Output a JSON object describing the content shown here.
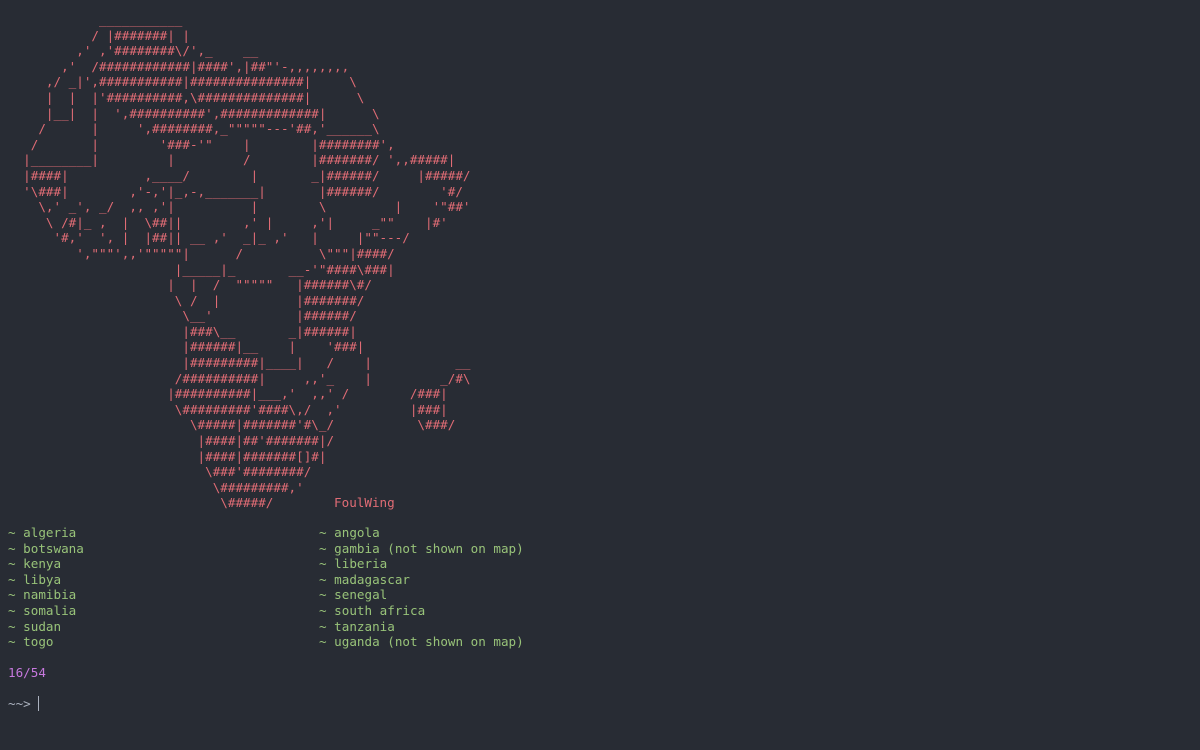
{
  "art": {
    "lines": [
      "            ___________",
      "           / |#######| |",
      "         ,' ,'########\\/',_    __",
      "       ,'  /############|####',|##\"'-,,,,,,,,",
      "     ,/ _|',###########|###############|     \\",
      "     |  |  |'##########,\\##############|      \\",
      "     |__|  |  ',##########',#############|      \\",
      "    /      |     ',########,_\"\"\"\"\"---'##,'______\\",
      "   /       |        '###-'\"    |        |########',",
      "  |________|         |         /        |#######/ ',,#####|",
      "  |####|          ,____/        |       _|######/     |#####/",
      "  '\\###|        ,'-,'|_,-,_______|       |######/        '#/",
      "    \\,' _', _/  ,, ,'|          |        \\         |    '\"##'",
      "     \\ /#|_ ,  |  \\##||        ,' |     ,'|     _\"\"    |#'",
      "      '#,'  ', |  |##|| __ ,'  _|_ ,'   |     |\"\"---/",
      "         ',\"\"\"',,'\"\"\"\"\"|      /          \\\"\"\"|####/",
      "                      |_____|_       __-'\"####\\###|",
      "                     |  |  /  \"\"\"\"\"   |######\\#/",
      "                      \\ /  |          |#######/",
      "                       \\__'           |######/",
      "                       |###\\__       _|######|",
      "                       |######|__    |    '###|",
      "                       |#########|____|   /    |           __",
      "                      /##########|     ,,'_    |         _/#\\",
      "                     |##########|___,'  ,,' /        /###|",
      "                      \\#########'####\\,/  ,'         |###|",
      "                        \\#####|#######'#\\_/           \\###/",
      "                         |####|##'#######|/",
      "                         |####|#######[]#|",
      "                          \\###'########/",
      "                           \\#########,'",
      "                            \\#####/        FoulWing"
    ]
  },
  "countries": [
    "~ algeria",
    "~ angola",
    "~ botswana",
    "~ gambia (not shown on map)",
    "~ kenya",
    "~ liberia",
    "~ libya",
    "~ madagascar",
    "~ namibia",
    "~ senegal",
    "~ somalia",
    "~ south africa",
    "~ sudan",
    "~ tanzania",
    "~ togo",
    "~ uganda (not shown on map)"
  ],
  "progress": "16/54",
  "prompt": {
    "symbol": "~~>",
    "input": ""
  },
  "colors": {
    "background": "#282c34",
    "art": "#e06c75",
    "countries": "#98c379",
    "counter": "#c678dd",
    "prompt": "#abb2bf"
  }
}
